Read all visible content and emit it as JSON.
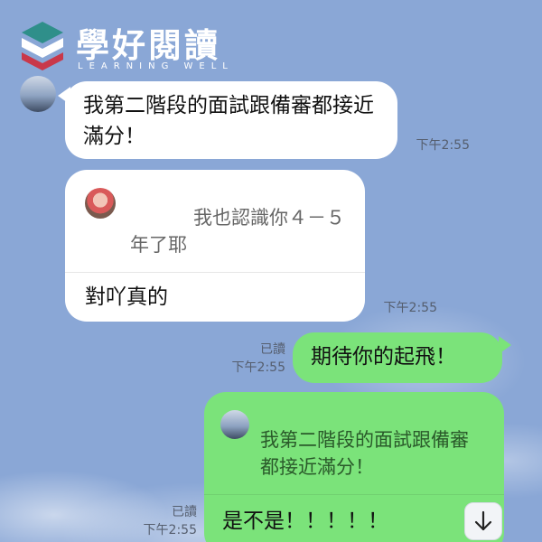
{
  "logo": {
    "title": "學好閱讀",
    "subtitle": "LEARNING WELL"
  },
  "messages": [
    {
      "side": "left",
      "text": "我第二階段的面試跟備審都接近滿分！",
      "time": "下午2:55"
    },
    {
      "side": "left",
      "quote": "我也認識你４－５年了耶",
      "text": "對吖真的",
      "time": "下午2:55"
    },
    {
      "side": "right",
      "text": "期待你的起飛！",
      "read": "已讀",
      "time": "下午2:55"
    },
    {
      "side": "right",
      "quote": "我第二階段的面試跟備審都接近滿分！",
      "text": "是不是！！！！！",
      "read": "已讀",
      "time": "下午2:55"
    }
  ],
  "icons": {
    "scroll_down": "arrow-down-icon"
  },
  "colors": {
    "background": "#8aa7d6",
    "bubble_in": "#ffffff",
    "bubble_out": "#7be37a"
  }
}
